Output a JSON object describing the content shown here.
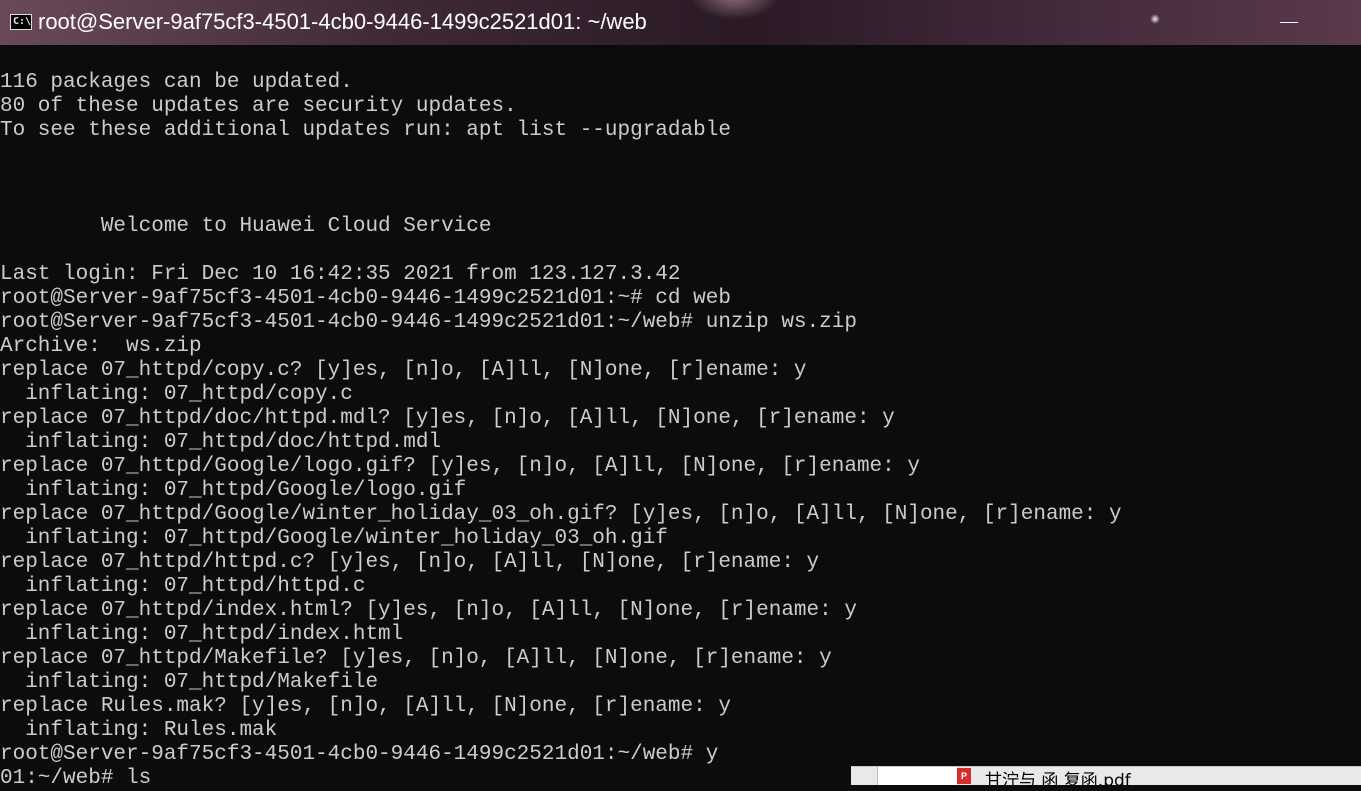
{
  "window": {
    "title": "root@Server-9af75cf3-4501-4cb0-9446-1499c2521d01: ~/web",
    "icon_label": "C:\\",
    "icons": {
      "app": "cmd-icon",
      "minimize": "minimize-icon",
      "close": "close-icon"
    }
  },
  "terminal": {
    "lines": [
      "",
      "116 packages can be updated.",
      "80 of these updates are security updates.",
      "To see these additional updates run: apt list --upgradable",
      "",
      "",
      "",
      "        Welcome to Huawei Cloud Service",
      "",
      "Last login: Fri Dec 10 16:42:35 2021 from 123.127.3.42",
      "root@Server-9af75cf3-4501-4cb0-9446-1499c2521d01:~# cd web",
      "root@Server-9af75cf3-4501-4cb0-9446-1499c2521d01:~/web# unzip ws.zip",
      "Archive:  ws.zip",
      "replace 07_httpd/copy.c? [y]es, [n]o, [A]ll, [N]one, [r]ename: y",
      "  inflating: 07_httpd/copy.c",
      "replace 07_httpd/doc/httpd.mdl? [y]es, [n]o, [A]ll, [N]one, [r]ename: y",
      "  inflating: 07_httpd/doc/httpd.mdl",
      "replace 07_httpd/Google/logo.gif? [y]es, [n]o, [A]ll, [N]one, [r]ename: y",
      "  inflating: 07_httpd/Google/logo.gif",
      "replace 07_httpd/Google/winter_holiday_03_oh.gif? [y]es, [n]o, [A]ll, [N]one, [r]ename: y",
      "  inflating: 07_httpd/Google/winter_holiday_03_oh.gif",
      "replace 07_httpd/httpd.c? [y]es, [n]o, [A]ll, [N]one, [r]ename: y",
      "  inflating: 07_httpd/httpd.c",
      "replace 07_httpd/index.html? [y]es, [n]o, [A]ll, [N]one, [r]ename: y",
      "  inflating: 07_httpd/index.html",
      "replace 07_httpd/Makefile? [y]es, [n]o, [A]ll, [N]one, [r]ename: y",
      "  inflating: 07_httpd/Makefile",
      "replace Rules.mak? [y]es, [n]o, [A]ll, [N]one, [r]ename: y",
      "  inflating: Rules.mak",
      "root@Server-9af75cf3-4501-4cb0-9446-1499c2521d01:~/web# y",
      "01:~/web# ls"
    ]
  },
  "taskbar": {
    "file_name": "甘泞与 函  复函.pdf",
    "file_icon_label": "P"
  },
  "colors": {
    "terminal_bg": "#0c0c0c",
    "terminal_fg": "#cccccc",
    "titlebar_text": "#ffffff",
    "pdf_icon": "#d32f2f"
  }
}
